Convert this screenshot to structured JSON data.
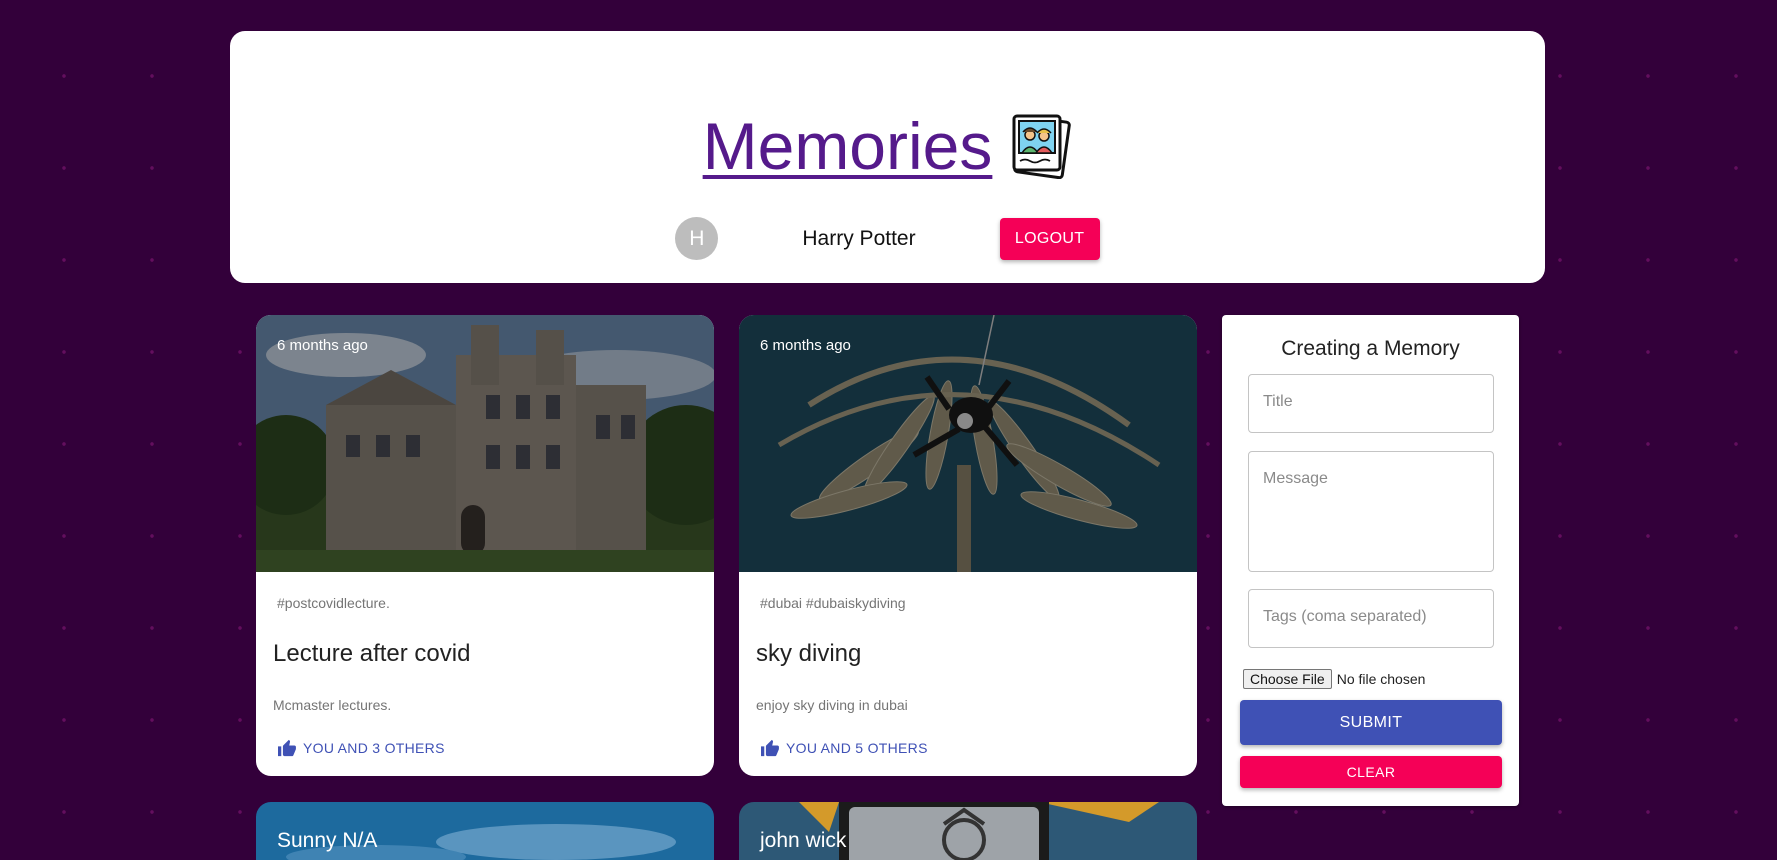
{
  "header": {
    "title": "Memories",
    "logo_icon": "memories-photo-icon",
    "user": {
      "avatar_letter": "H",
      "name": "Harry Potter"
    },
    "logout_label": "LOGOUT"
  },
  "posts": [
    {
      "time": "6 months ago",
      "tags": "#postcovidlecture.",
      "title": "Lecture after covid",
      "message": "Mcmaster lectures.",
      "likes": "YOU AND 3 OTHERS",
      "image": "university-building-photo"
    },
    {
      "time": "6 months ago",
      "tags": "#dubai #dubaiskydiving",
      "title": "sky diving",
      "message": "enjoy sky diving in dubai",
      "likes": "YOU AND 5 OTHERS",
      "image": "skydiving-palm-island-photo"
    },
    {
      "title": "Sunny N/A",
      "image": "blue-sky-photo"
    },
    {
      "title": "john wick",
      "image": "anime-character-photo"
    }
  ],
  "form": {
    "heading": "Creating a Memory",
    "title_placeholder": "Title",
    "message_placeholder": "Message",
    "tags_placeholder": "Tags (coma separated)",
    "file_button": "Choose File",
    "file_status": "No file chosen",
    "submit_label": "SUBMIT",
    "clear_label": "CLEAR"
  },
  "colors": {
    "background": "#33003a",
    "primary": "#3f51b5",
    "secondary": "#f50057",
    "title": "#551a8b"
  }
}
